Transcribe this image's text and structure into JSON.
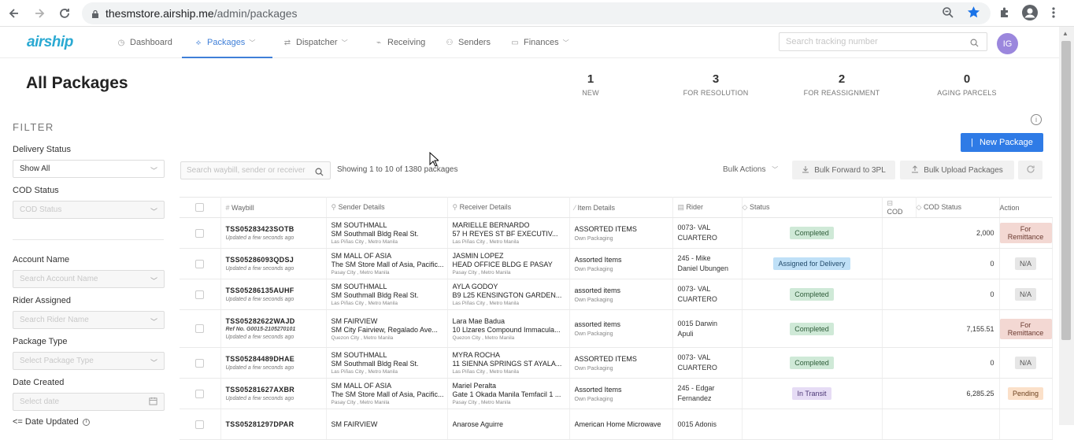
{
  "browser": {
    "url_host": "thesmstore.airship.me",
    "url_path": "/admin/packages"
  },
  "header": {
    "logo": "airship",
    "nav": [
      {
        "label": "Dashboard"
      },
      {
        "label": "Packages"
      },
      {
        "label": "Dispatcher"
      },
      {
        "label": "Receiving"
      },
      {
        "label": "Senders"
      },
      {
        "label": "Finances"
      }
    ],
    "search_placeholder": "Search tracking number",
    "avatar_initials": "IG"
  },
  "page": {
    "title": "All Packages",
    "stats": [
      {
        "value": "1",
        "label": "NEW"
      },
      {
        "value": "3",
        "label": "FOR RESOLUTION"
      },
      {
        "value": "2",
        "label": "FOR REASSIGNMENT"
      },
      {
        "value": "0",
        "label": "AGING PARCELS"
      }
    ]
  },
  "filter": {
    "title": "FILTER",
    "delivery_status_label": "Delivery Status",
    "delivery_status_value": "Show All",
    "cod_status_label": "COD Status",
    "cod_status_placeholder": "COD Status",
    "account_name_label": "Account Name",
    "account_name_placeholder": "Search Account Name",
    "rider_label": "Rider Assigned",
    "rider_placeholder": "Search Rider Name",
    "package_type_label": "Package Type",
    "package_type_placeholder": "Select Package Type",
    "date_created_label": "Date Created",
    "date_created_placeholder": "Select date",
    "date_updated_label": "<= Date Updated"
  },
  "toolbar": {
    "new_package": "New Package",
    "search_placeholder": "Search waybill, sender or receiver",
    "showing": "Showing 1 to 10 of 1380 packages",
    "bulk_actions": "Bulk Actions",
    "bulk_forward": "Bulk Forward to 3PL",
    "bulk_upload": "Bulk Upload Packages"
  },
  "table": {
    "headers": {
      "waybill": "Waybill",
      "sender": "Sender Details",
      "receiver": "Receiver Details",
      "item": "Item Details",
      "rider": "Rider",
      "status": "Status",
      "cod": "COD",
      "cod_status": "COD Status",
      "action": "Action"
    },
    "rows": [
      {
        "waybill": "TSS05283423SOTB",
        "ref": "",
        "updated": "Updated a few seconds ago",
        "s1": "SM SOUTHMALL",
        "s2": "SM Southmall Bldg Real St.",
        "s3": "Las Piñas City , Metro Manila",
        "r1": "MARIELLE BERNARDO",
        "r2": "57 H REYES ST BF EXECUTIV...",
        "r3": "Las Piñas City , Metro Manila",
        "i1": "ASSORTED ITEMS",
        "i2": "Own Packaging",
        "rider": "0073- VAL CUARTERO",
        "status": "Completed",
        "cod": "2,000",
        "cod_status": "For Remittance"
      },
      {
        "waybill": "TSS05286093QDSJ",
        "ref": "",
        "updated": "Updated a few seconds ago",
        "s1": "SM MALL OF ASIA",
        "s2": "The SM Store Mall of Asia, Pacific...",
        "s3": "Pasay City , Metro Manila",
        "r1": "JASMIN LOPEZ",
        "r2": "HEAD OFFICE BLDG E PASAY",
        "r3": "Pasay City , Metro Manila",
        "i1": "Assorted Items",
        "i2": "Own Packaging",
        "rider": "245 - Mike Daniel Ubungen",
        "status": "Assigned for Delivery",
        "cod": "0",
        "cod_status": "N/A"
      },
      {
        "waybill": "TSS05286135AUHF",
        "ref": "",
        "updated": "Updated a few seconds ago",
        "s1": "SM SOUTHMALL",
        "s2": "SM Southmall Bldg Real St.",
        "s3": "Las Piñas City , Metro Manila",
        "r1": "AYLA GODOY",
        "r2": "B9 L25 KENSINGTON GARDEN...",
        "r3": "Las Piñas City , Metro Manila",
        "i1": "assorted items",
        "i2": "Own Packaging",
        "rider": "0073- VAL CUARTERO",
        "status": "Completed",
        "cod": "0",
        "cod_status": "N/A"
      },
      {
        "waybill": "TSS05282622WAJD",
        "ref": "Ref No. G0015-2105270101",
        "updated": "Updated a few seconds ago",
        "s1": "SM FAIRVIEW",
        "s2": "SM City Fairview, Regalado Ave...",
        "s3": "Quezon City , Metro Manila",
        "r1": "Lara Mae Badua",
        "r2": "10 Llzares Compound Immacula...",
        "r3": "Quezon City , Metro Manila",
        "i1": "assorted items",
        "i2": "Own Packaging",
        "rider": "0015 Darwin Apuli",
        "status": "Completed",
        "cod": "7,155.51",
        "cod_status": "For Remittance"
      },
      {
        "waybill": "TSS05284489DHAE",
        "ref": "",
        "updated": "Updated a few seconds ago",
        "s1": "SM SOUTHMALL",
        "s2": "SM Southmall Bldg Real St.",
        "s3": "Las Piñas City , Metro Manila",
        "r1": "MYRA ROCHA",
        "r2": "11 SIENNA SPRINGS ST AYALA...",
        "r3": "Las Piñas City , Metro Manila",
        "i1": "ASSORTED ITEMS",
        "i2": "Own Packaging",
        "rider": "0073- VAL CUARTERO",
        "status": "Completed",
        "cod": "0",
        "cod_status": "N/A"
      },
      {
        "waybill": "TSS05281627AXBR",
        "ref": "",
        "updated": "Updated a few seconds ago",
        "s1": "SM MALL OF ASIA",
        "s2": "The SM Store Mall of Asia, Pacific...",
        "s3": "Pasay City , Metro Manila",
        "r1": "Mariel Peralta",
        "r2": "Gate 1 Okada Manila Temfacil 1 ...",
        "r3": "Pasay City , Metro Manila",
        "i1": "Assorted Items",
        "i2": "Own Packaging",
        "rider": "245 - Edgar Fernandez",
        "status": "In Transit",
        "cod": "6,285.25",
        "cod_status": "Pending"
      },
      {
        "waybill": "TSS05281297DPAR",
        "ref": "",
        "updated": "",
        "s1": "SM FAIRVIEW",
        "s2": "",
        "s3": "",
        "r1": "Anarose Aguirre",
        "r2": "",
        "r3": "",
        "i1": "American Home Microwave",
        "i2": "",
        "rider": "0015 Adonis",
        "status": "",
        "cod": "",
        "cod_status": ""
      }
    ]
  },
  "colors": {
    "accent": "#2f7be6",
    "nav_active": "#3f7fd8",
    "avatar": "#9b87dd",
    "logo": "#2aa9d2"
  }
}
